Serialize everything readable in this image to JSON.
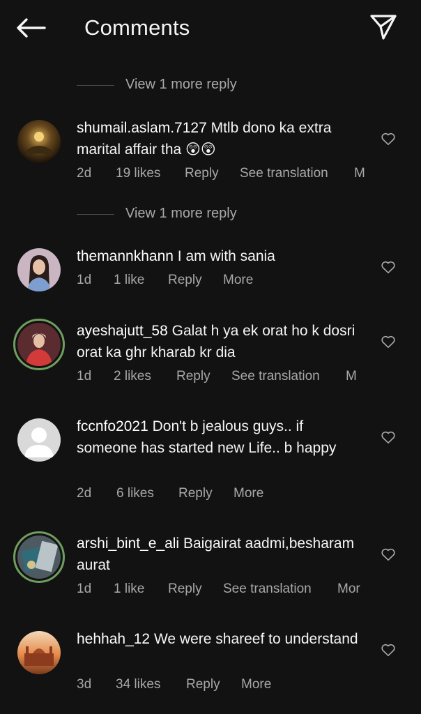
{
  "header": {
    "title": "Comments"
  },
  "view_more": [
    "View 1 more reply",
    "View 1 more reply"
  ],
  "comments": [
    {
      "user": "shumail.aslam.7127",
      "text": "Mtlb dono ka extra marital affair tha 😲😲",
      "time": "2d",
      "likes": "19 likes",
      "reply": "Reply",
      "extra": "See translation",
      "more": "M"
    },
    {
      "user": "themannkhann",
      "text": "I am with sania",
      "time": "1d",
      "likes": "1 like",
      "reply": "Reply",
      "more": "More"
    },
    {
      "user": "ayeshajutt_58",
      "text": "Galat h ya ek orat ho k dosri orat ka ghr kharab kr dia",
      "time": "1d",
      "likes": "2 likes",
      "reply": "Reply",
      "extra": "See translation",
      "more": "M"
    },
    {
      "user": "fccnfo2021",
      "text": "Don't b jealous guys.. if someone has started new Life.. b happy",
      "time": "2d",
      "likes": "6 likes",
      "reply": "Reply",
      "more": "More"
    },
    {
      "user": "arshi_bint_e_ali",
      "text": "Baigairat aadmi,besharam aurat",
      "time": "1d",
      "likes": "1 like",
      "reply": "Reply",
      "extra": "See translation",
      "more": "Mor"
    },
    {
      "user": "hehhah_12",
      "text": "We were shareef to understand",
      "time": "3d",
      "likes": "34 likes",
      "reply": "Reply",
      "more": "More"
    }
  ],
  "colors": {
    "background": "#121212",
    "primary_text": "#f5f5f5",
    "secondary_text": "#a8a8a8",
    "story_ring": "#6f9e5e"
  },
  "icons": {
    "back": "arrow-left-icon",
    "share": "paper-plane-icon",
    "like": "heart-outline-icon",
    "default_avatar": "person-silhouette-icon"
  }
}
